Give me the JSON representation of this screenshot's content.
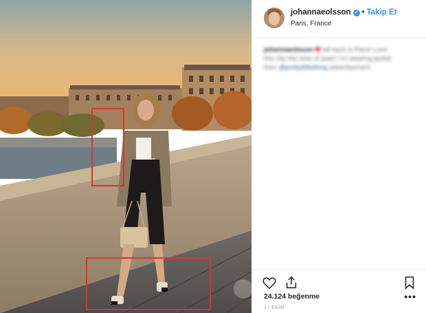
{
  "post": {
    "username": "johannaeolsson",
    "separator": "•",
    "follow_label": "Takip Et",
    "location": "Paris, France",
    "caption_user": "johannaeolsson",
    "caption_text": "fall back in Paris! Love this city this time of year!! I'm wearing jacket from",
    "caption_link": "@prettylittlething",
    "caption_tail": "advertisement",
    "likes": "24.124 beğenme",
    "date": "17 EKİM",
    "more_label": "•••"
  },
  "icons": [
    "heart-outline-icon",
    "share-icon",
    "bookmark-icon",
    "verified-badge-icon",
    "more-dots-icon"
  ],
  "colors": {
    "accent": "#3897f0",
    "annotation_box": "#e03030",
    "text": "#262626"
  }
}
